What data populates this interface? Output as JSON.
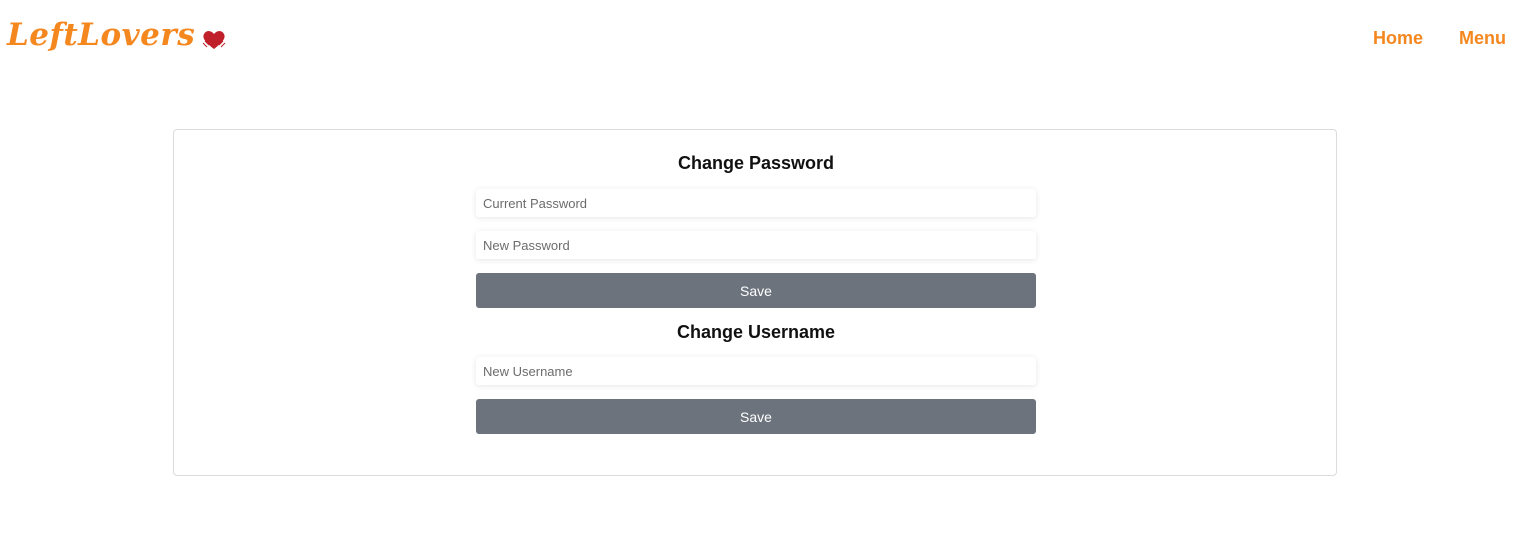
{
  "brand": {
    "name": "LeftLovers",
    "color": "#f5871f",
    "icon": "heart-icon"
  },
  "nav": {
    "items": [
      {
        "label": "Home"
      },
      {
        "label": "Menu"
      }
    ]
  },
  "password_section": {
    "title": "Change Password",
    "current_password": {
      "placeholder": "Current Password",
      "value": ""
    },
    "new_password": {
      "placeholder": "New Password",
      "value": ""
    },
    "save_label": "Save"
  },
  "username_section": {
    "title": "Change Username",
    "new_username": {
      "placeholder": "New Username",
      "value": ""
    },
    "save_label": "Save"
  },
  "colors": {
    "accent": "#f5871f",
    "button": "#6c737d",
    "heart": "#c0202a"
  }
}
